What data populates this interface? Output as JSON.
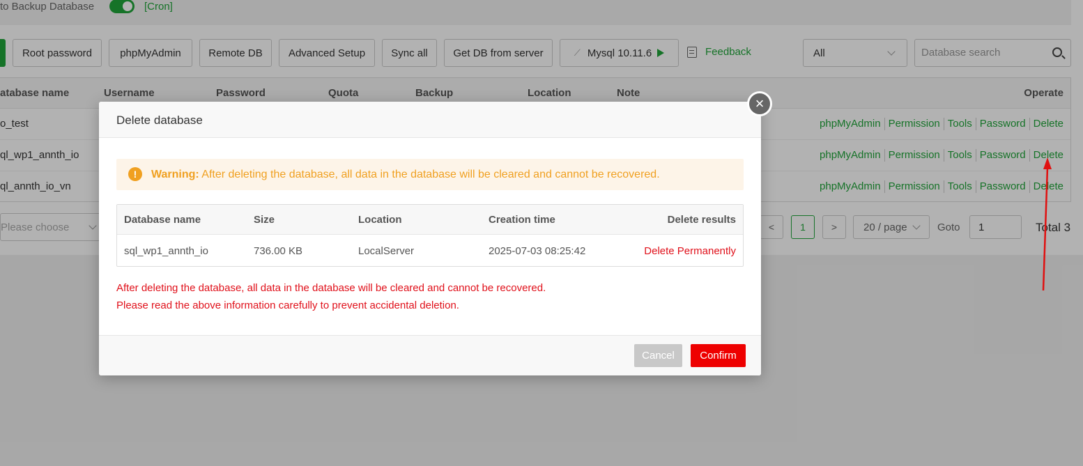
{
  "backup_bar": {
    "label": "to Backup Database",
    "cron": "[Cron]"
  },
  "toolbar": {
    "root_password": "Root password",
    "phpmyadmin": "phpMyAdmin",
    "remote_db": "Remote DB",
    "advanced_setup": "Advanced Setup",
    "sync_all": "Sync all",
    "get_db": "Get DB from server",
    "mysql": "Mysql 10.11.6",
    "feedback": "Feedback",
    "filter_value": "All",
    "search_placeholder": "Database search"
  },
  "table": {
    "headers": [
      "atabase name",
      "Username",
      "Password",
      "Quota",
      "Backup",
      "Location",
      "Note",
      "Operate"
    ],
    "rows": [
      {
        "name": "o_test"
      },
      {
        "name": "ql_wp1_annth_io"
      },
      {
        "name": "ql_annth_io_vn"
      }
    ],
    "ops": [
      "phpMyAdmin",
      "Permission",
      "Tools",
      "Password",
      "Delete"
    ]
  },
  "footer": {
    "select_placeholder": "Please choose",
    "page_prev": "<",
    "page_current": "1",
    "page_next": ">",
    "page_size": "20 / page",
    "goto_label": "Goto",
    "goto_value": "1",
    "total": "Total 3"
  },
  "modal": {
    "title": "Delete database",
    "close": "×",
    "warning_icon": "!",
    "warning_bold": "Warning:",
    "warning_text": " After deleting the database, all data in the database will be cleared and cannot be recovered.",
    "columns": [
      "Database name",
      "Size",
      "Location",
      "Creation time",
      "Delete results"
    ],
    "row": {
      "name": "sql_wp1_annth_io",
      "size": "736.00 KB",
      "location": "LocalServer",
      "created": "2025-07-03 08:25:42",
      "result": "Delete Permanently"
    },
    "note_1": "After deleting the database, all data in the database will be cleared and cannot be recovered.",
    "note_2": "Please read the above information carefully to prevent accidental deletion.",
    "cancel": "Cancel",
    "confirm": "Confirm"
  },
  "colors": {
    "brand_green": "#20a53a",
    "danger_red": "#ee0000",
    "warning_orange": "#f0a020"
  }
}
